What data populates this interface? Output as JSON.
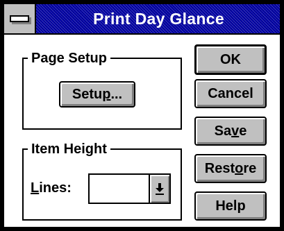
{
  "window": {
    "title": "Print Day Glance"
  },
  "page_setup": {
    "label": "Page Setup",
    "setup_button": {
      "before": "Setu",
      "mnemonic": "p",
      "after": "..."
    }
  },
  "item_height": {
    "label": "Item Height",
    "lines_label": {
      "mnemonic": "L",
      "after": "ines:"
    },
    "lines_value": ""
  },
  "buttons": {
    "ok": "OK",
    "cancel": "Cancel",
    "save": {
      "before": "Sa",
      "mnemonic": "v",
      "after": "e"
    },
    "restore": {
      "before": "Rest",
      "mnemonic": "o",
      "after": "re"
    },
    "help": "Help"
  },
  "icons": {
    "system_menu": "system-menu-icon",
    "dropdown": "dropdown-arrow-icon"
  },
  "colors": {
    "titlebar": "#0000a8",
    "face": "#c0c0c0",
    "background": "#ffffff"
  }
}
